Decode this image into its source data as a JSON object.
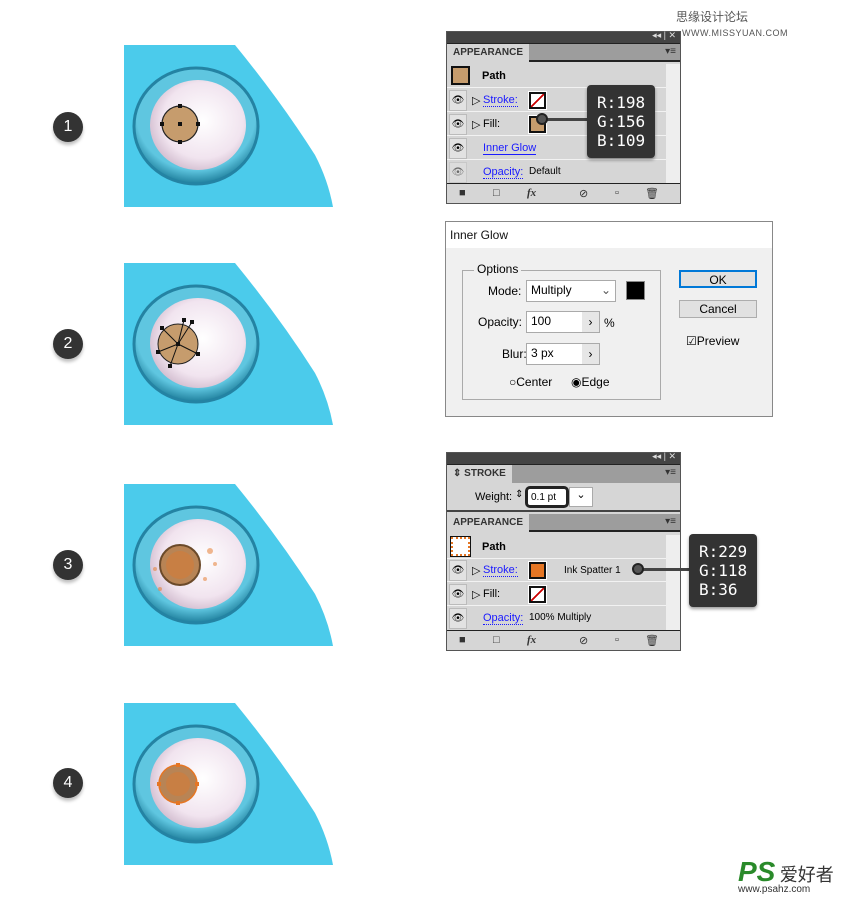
{
  "watermark_top": {
    "cn": "思缘设计论坛",
    "url": "WWW.MISSYUAN.COM"
  },
  "watermark_bottom": {
    "logo": "PS",
    "cn": "爱好者",
    "url": "www.psahz.com"
  },
  "steps": [
    "1",
    "2",
    "3",
    "4"
  ],
  "appearance1": {
    "tab": "APPEARANCE",
    "title": "Path",
    "path_color": "#c69c6d",
    "rows": [
      {
        "label": "Stroke:",
        "swatch": "none"
      },
      {
        "label": "Fill:",
        "swatch": "#c69c6d"
      },
      {
        "label": "Inner Glow"
      },
      {
        "label": "Opacity:",
        "value": "Default"
      }
    ]
  },
  "tooltip1": {
    "r": "R:198",
    "g": "G:156",
    "b": "B:109"
  },
  "inner_glow": {
    "title": "Inner Glow",
    "group": "Options",
    "mode_label": "Mode:",
    "mode": "Multiply",
    "color": "#000000",
    "opacity_label": "Opacity:",
    "opacity": "100",
    "opacity_unit": "%",
    "blur_label": "Blur:",
    "blur": "3 px",
    "center": "Center",
    "edge": "Edge",
    "selected": "Edge",
    "ok": "OK",
    "cancel": "Cancel",
    "preview": "Preview",
    "preview_checked": true
  },
  "stroke_panel": {
    "tab": "STROKE",
    "weight_label": "Weight:",
    "weight": "0.1 pt"
  },
  "appearance2": {
    "tab": "APPEARANCE",
    "title": "Path",
    "rows": [
      {
        "label": "Stroke:",
        "swatch": "#e57624",
        "brush": "Ink Spatter 1"
      },
      {
        "label": "Fill:",
        "swatch": "none"
      },
      {
        "label": "Opacity:",
        "value": "100% Multiply"
      }
    ]
  },
  "tooltip2": {
    "r": "R:229",
    "g": "G:118",
    "b": "B:36"
  },
  "colors": {
    "cyan": "#4bcbeb",
    "ring": "#2b9cbf",
    "iris": "#c69c6d",
    "spatter": "#e57624"
  }
}
